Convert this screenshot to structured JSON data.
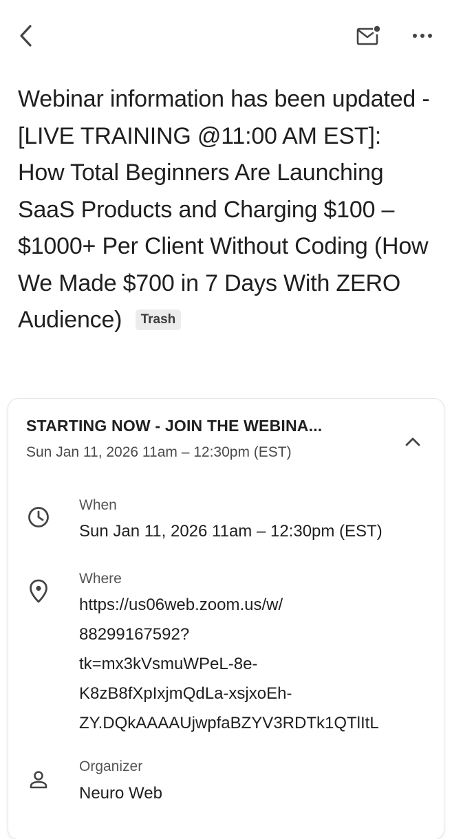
{
  "toolbar": {
    "back_icon": "chevron-left-icon",
    "mark_unread_icon": "mail-unread-icon",
    "more_icon": "more-horizontal-icon"
  },
  "email": {
    "subject": "Webinar information has been updated - [LIVE TRAINING @11:00 AM EST]: How Total Beginners Are Launching SaaS Products and Charging $100 –$1000+ Per Client Without Coding (How We Made $700 in 7 Days With ZERO Audience)",
    "label_chip": "Trash"
  },
  "event_card": {
    "title": "STARTING NOW - JOIN THE WEBINA...",
    "subtitle": "Sun Jan 11, 2026 11am – 12:30pm (EST)",
    "collapse_icon": "chevron-up-icon",
    "when": {
      "label": "When",
      "value": "Sun Jan 11, 2026 11am – 12:30pm (EST)"
    },
    "where": {
      "label": "Where",
      "value_lines": [
        "https://us06web.zoom.us/w/",
        "88299167592?",
        "tk=mx3kVsmuWPeL-8e-",
        "K8zB8fXpIxjmQdLa-xsjxoEh-",
        "ZY.DQkAAAAUjwpfaBZYV3RDTk1QTlItL"
      ]
    },
    "organizer": {
      "label": "Organizer",
      "value": "Neuro Web"
    }
  },
  "colors": {
    "text_primary": "#1f1f1f",
    "text_secondary": "#4a4a4a",
    "chip_bg": "#ececec"
  }
}
